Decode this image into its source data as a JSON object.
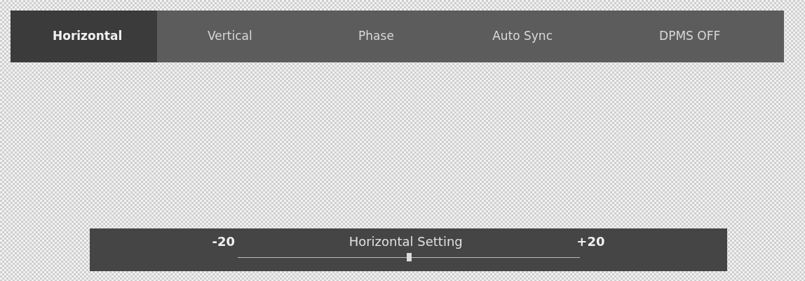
{
  "tabs": [
    {
      "label": "Horizontal",
      "selected": true
    },
    {
      "label": "Vertical",
      "selected": false
    },
    {
      "label": "Phase",
      "selected": false
    },
    {
      "label": "Auto Sync",
      "selected": false
    },
    {
      "label": "DPMS OFF",
      "selected": false
    }
  ],
  "slider": {
    "min_label": "-20",
    "title": "Horizontal Setting",
    "max_label": "+20",
    "level": 0.5
  }
}
